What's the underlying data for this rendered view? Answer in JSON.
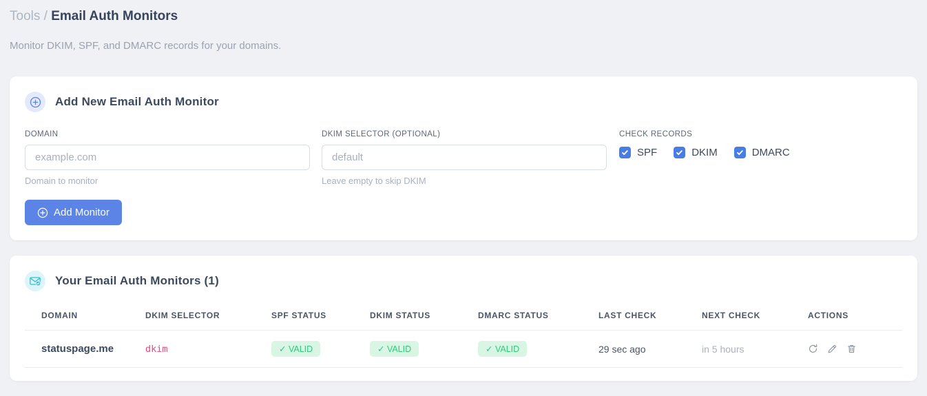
{
  "page": {
    "breadcrumb": {
      "parent": "Tools",
      "separator": "/",
      "current": "Email Auth Monitors"
    },
    "subtitle": "Monitor DKIM, SPF, and DMARC records for your domains."
  },
  "add_card": {
    "icon": "plus-circle-icon",
    "title": "Add New Email Auth Monitor",
    "fields": {
      "domain": {
        "label": "DOMAIN",
        "placeholder": "example.com",
        "value": "",
        "helper": "Domain to monitor"
      },
      "dkim_selector": {
        "label": "DKIM SELECTOR (OPTIONAL)",
        "placeholder": "default",
        "value": "",
        "helper": "Leave empty to skip DKIM"
      }
    },
    "check_records": {
      "label": "CHECK RECORDS",
      "options": [
        {
          "label": "SPF",
          "checked": true
        },
        {
          "label": "DKIM",
          "checked": true
        },
        {
          "label": "DMARC",
          "checked": true
        }
      ]
    },
    "submit": {
      "icon": "plus-circle-icon",
      "label": "Add Monitor"
    }
  },
  "monitors_card": {
    "icon": "email-check-icon",
    "title": "Your Email Auth Monitors (1)",
    "count": 1,
    "table": {
      "headers": [
        "DOMAIN",
        "DKIM SELECTOR",
        "SPF STATUS",
        "DKIM STATUS",
        "DMARC STATUS",
        "LAST CHECK",
        "NEXT CHECK",
        "ACTIONS"
      ],
      "rows": [
        {
          "domain": "statuspage.me",
          "dkim_selector": "dkim",
          "spf_status": "✓ VALID",
          "dkim_status": "✓ VALID",
          "dmarc_status": "✓ VALID",
          "last_check": "29 sec ago",
          "next_check": "in 5 hours",
          "actions": [
            "refresh-icon",
            "edit-icon",
            "delete-icon"
          ]
        }
      ]
    }
  },
  "colors": {
    "page_background": "#f0f1f4",
    "card_background": "#ffffff",
    "accent_blue": "#5b84e6",
    "checkbox_blue": "#4a7de4",
    "badge_icon_blue_bg": "#e3eafc",
    "badge_icon_teal_bg": "#dcf5f9",
    "teal": "#2bc3d8",
    "valid_badge_bg": "#d9f6e4",
    "valid_badge_text": "#2dc97d",
    "selector_pink": "#e8477e",
    "heading": "#37445c",
    "muted": "#a9b1be"
  }
}
